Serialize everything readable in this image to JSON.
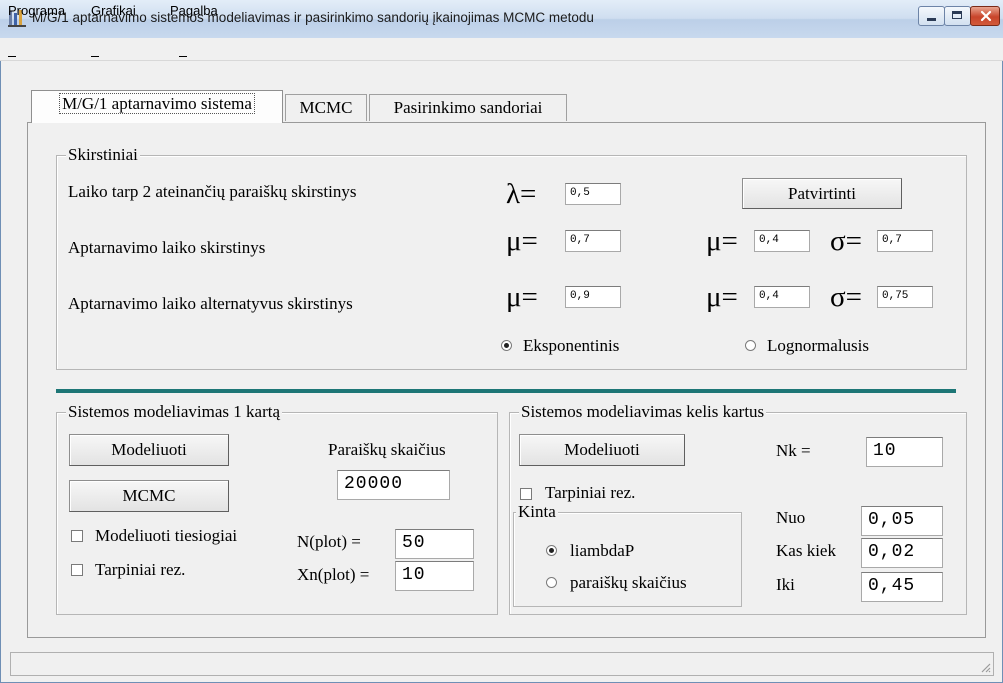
{
  "window": {
    "title": "M/G/1 aptarnavimo sistemos modeliavimas ir pasirinkimo sandorių įkainojimas MCMC metodu",
    "controls": {
      "minimize": "–",
      "maximize": "□",
      "close": "x"
    }
  },
  "menu": [
    "Programa",
    "Grafikai",
    "Pagalba"
  ],
  "tabs": [
    "M/G/1 aptarnavimo sistema",
    "MCMC",
    "Pasirinkimo sandoriai"
  ],
  "skirstiniai": {
    "legend": "Skirstiniai",
    "row1_label": "Laiko tarp 2 ateinančių paraiškų skirstinys",
    "row2_label": "Aptarnavimo laiko skirstinys",
    "row3_label": "Aptarnavimo laiko alternatyvus skirstinys",
    "lambda_symbol": "λ=",
    "mu_symbol": "μ=",
    "sigma_symbol": "σ=",
    "lambda_value": "0,5",
    "mu1_value": "0,7",
    "mu2_value": "0,4",
    "sigma2_value": "0,7",
    "mu3_value": "0,9",
    "mu4_value": "0,4",
    "sigma4_value": "0,75",
    "confirm_button": "Patvirtinti",
    "radio_exp": "Eksponentinis",
    "radio_lognorm": "Lognormalusis",
    "selected": "Eksponentinis"
  },
  "single": {
    "legend": "Sistemos modeliavimas 1 kartą",
    "model_button": "Modeliuoti",
    "mcmc_button": "MCMC",
    "count_label": "Paraiškų skaičius",
    "count_value": "20000",
    "direct_checkbox": "Modeliuoti tiesiogiai",
    "intermediate_checkbox": "Tarpiniai rez.",
    "nplot_label": "N(plot) =",
    "nplot_value": "50",
    "xnplot_label": "Xn(plot) =",
    "xnplot_value": "10"
  },
  "multi": {
    "legend": "Sistemos modeliavimas kelis kartus",
    "model_button": "Modeliuoti",
    "nk_label": "Nk =",
    "nk_value": "10",
    "intermediate_checkbox": "Tarpiniai rez.",
    "kinta_legend": "Kinta",
    "radio_lambda": "liambdaP",
    "radio_count": "paraiškų skaičius",
    "selected": "liambdaP",
    "from_label": "Nuo",
    "from_value": "0,05",
    "step_label": "Kas kiek",
    "step_value": "0,02",
    "to_label": "Iki",
    "to_value": "0,45"
  },
  "colors": {
    "divider": "#1d7676",
    "titlebar": "#c8d9ee",
    "close_button": "#c8452b"
  }
}
